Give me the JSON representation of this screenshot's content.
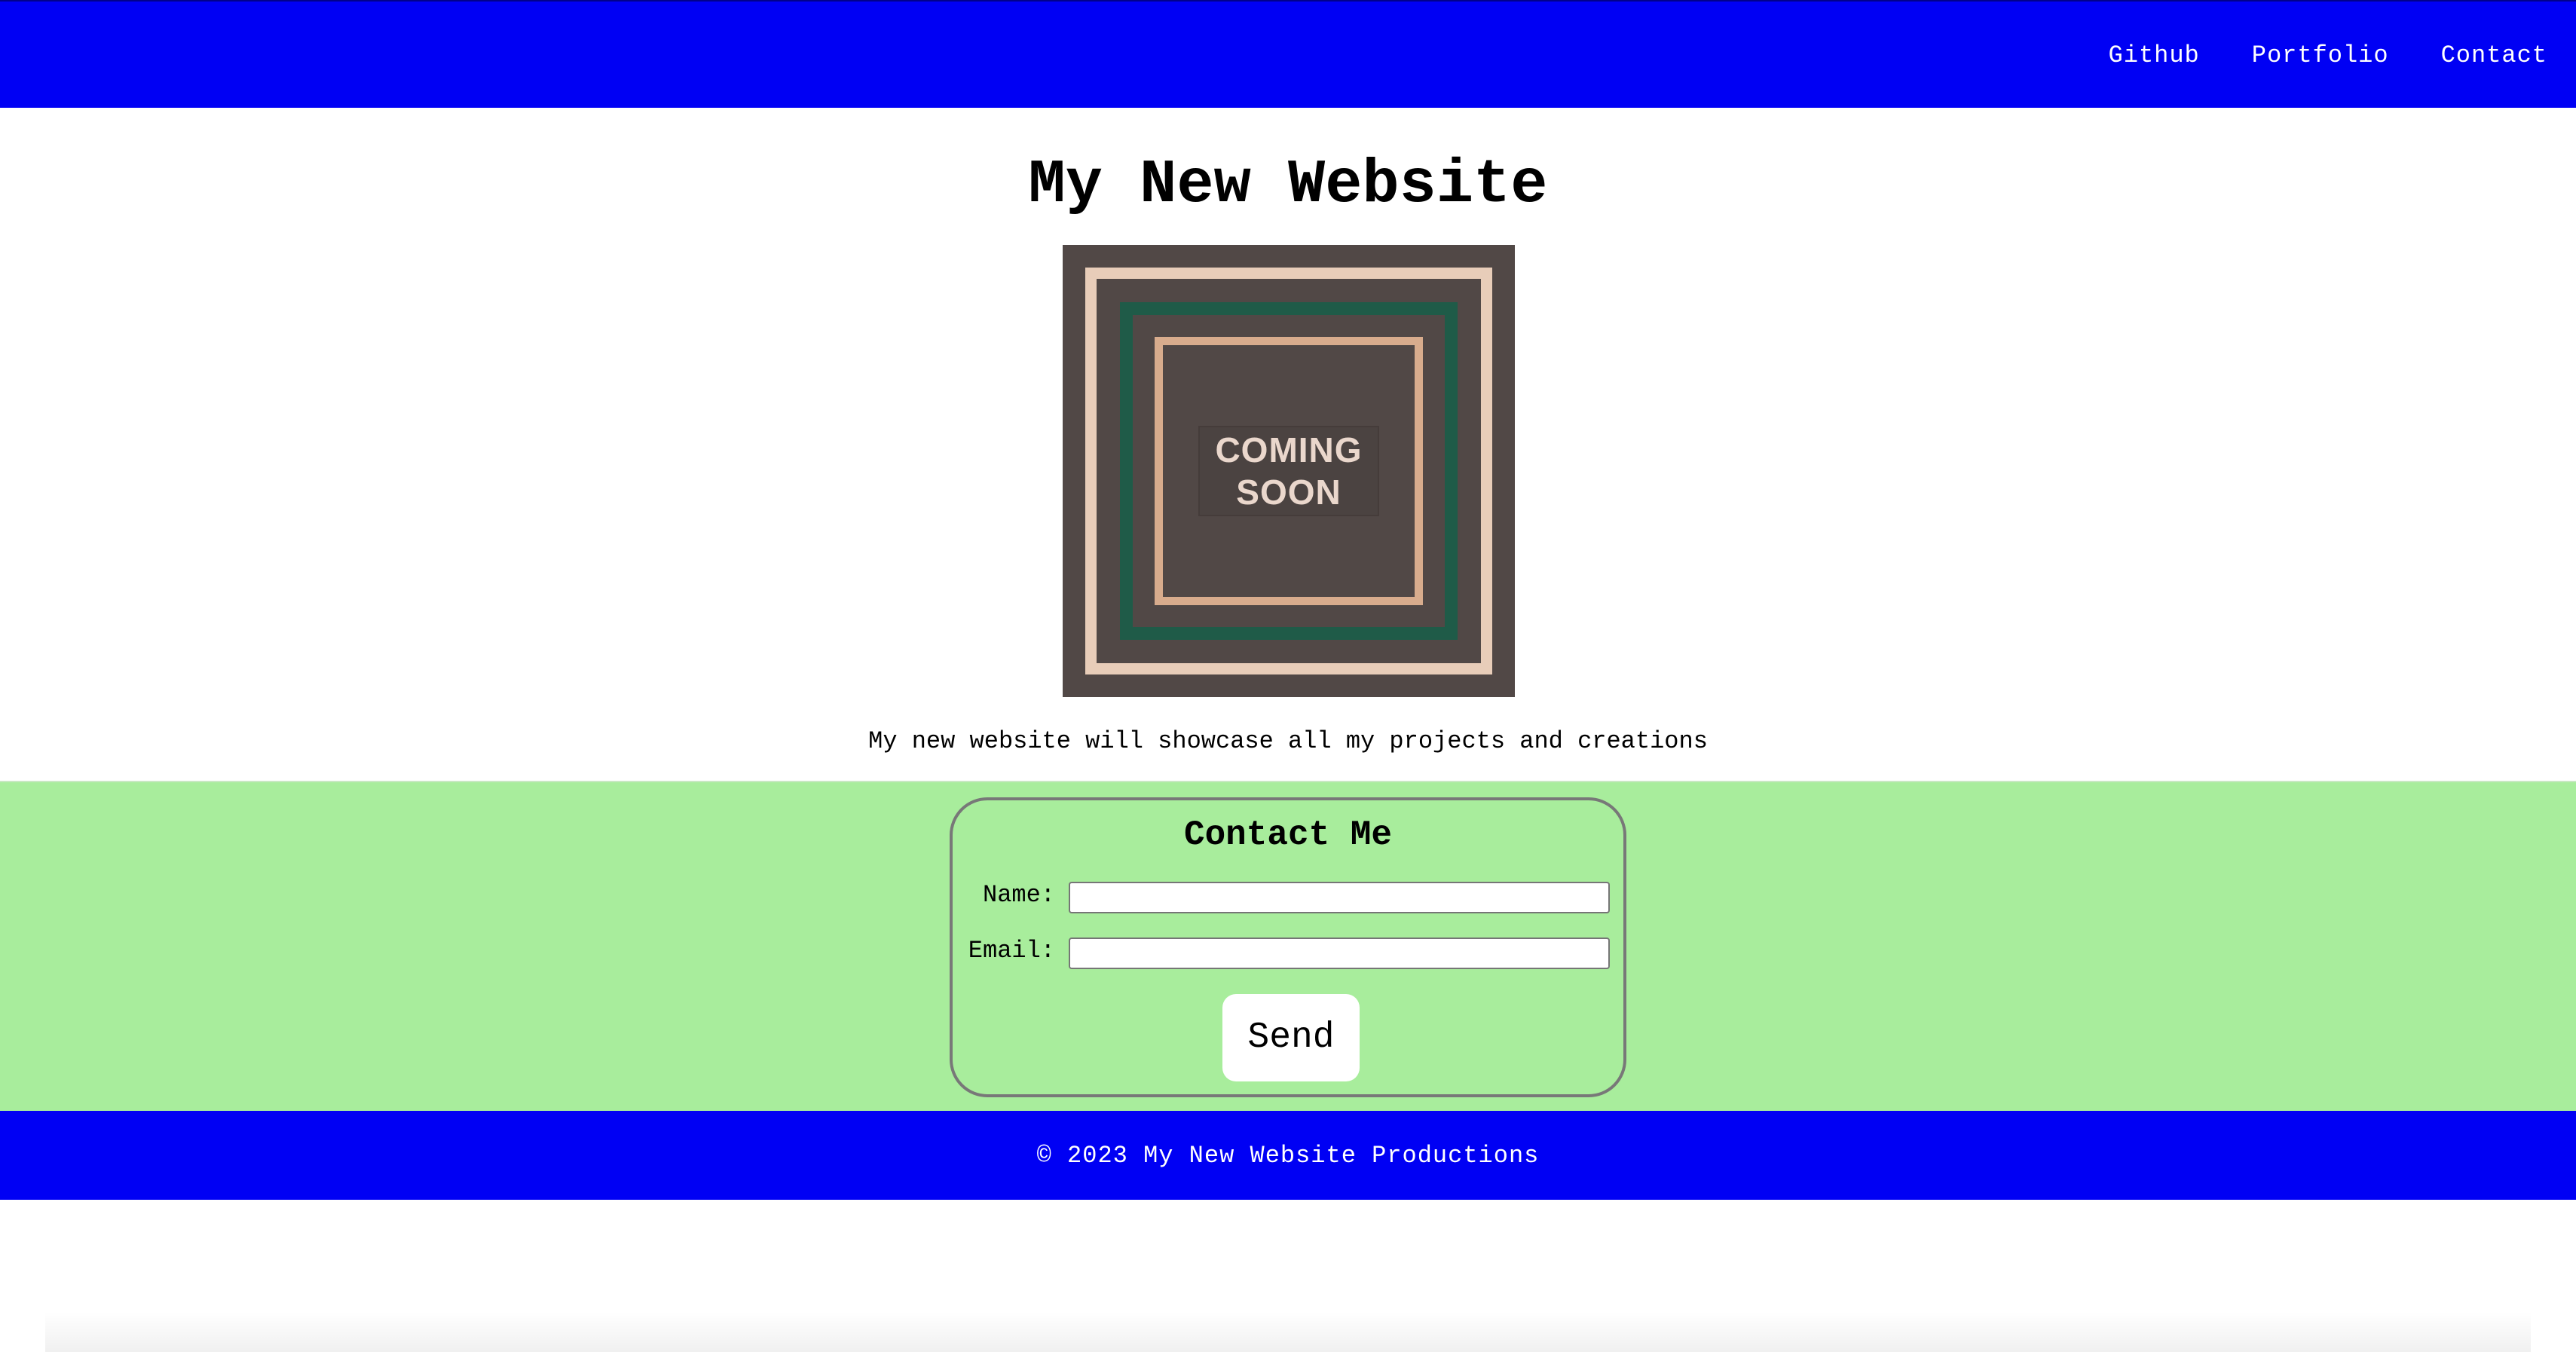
{
  "header": {
    "nav": [
      {
        "label": "Github"
      },
      {
        "label": "Portfolio"
      },
      {
        "label": "Contact"
      }
    ]
  },
  "main": {
    "title": "My New Website",
    "hero_image": {
      "line1": "COMING",
      "line2": "SOON"
    },
    "tagline": "My new website will showcase all my projects and creations"
  },
  "contact": {
    "title": "Contact Me",
    "name_label": "Name:",
    "name_value": "",
    "email_label": "Email:",
    "email_value": "",
    "send_label": "Send"
  },
  "footer": {
    "text": "© 2023 My New Website Productions"
  },
  "colors": {
    "header_bg": "#0000f4",
    "contact_bg": "#a8ed9c",
    "hero_bg": "#514846"
  }
}
